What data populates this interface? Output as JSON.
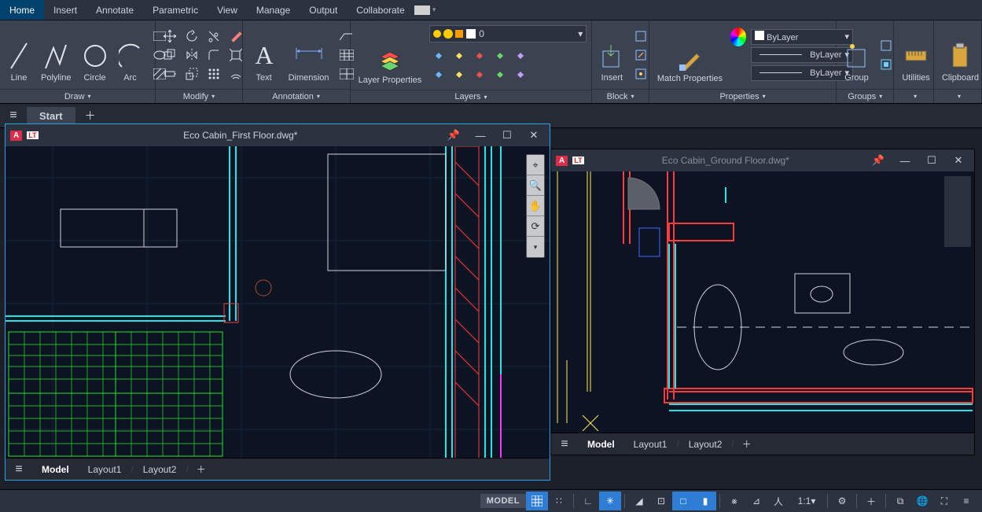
{
  "menubar": [
    "Home",
    "Insert",
    "Annotate",
    "Parametric",
    "View",
    "Manage",
    "Output",
    "Collaborate"
  ],
  "menubar_active": 0,
  "ribbon": {
    "draw": {
      "label": "Draw",
      "buttons": [
        "Line",
        "Polyline",
        "Circle",
        "Arc"
      ]
    },
    "modify": {
      "label": "Modify"
    },
    "annotation": {
      "label": "Annotation",
      "text": "Text",
      "dimension": "Dimension"
    },
    "layers": {
      "label": "Layers",
      "layer_props": "Layer\nProperties",
      "current_layer": "0"
    },
    "block": {
      "label": "Block",
      "insert": "Insert"
    },
    "properties": {
      "label": "Properties",
      "match": "Match\nProperties",
      "color": "ByLayer",
      "lw": "ByLayer",
      "lt": "ByLayer"
    },
    "groups": {
      "label": "Groups",
      "group": "Group"
    },
    "utilities": {
      "label": "Utilities"
    },
    "clipboard": {
      "label": "Clipboard"
    }
  },
  "doctab": {
    "start": "Start"
  },
  "windows": [
    {
      "title": "Eco Cabin_First Floor.dwg*",
      "active": true,
      "layout_tabs": [
        "Model",
        "Layout1",
        "Layout2"
      ],
      "active_layout": 0
    },
    {
      "title": "Eco Cabin_Ground Floor.dwg*",
      "active": false,
      "layout_tabs": [
        "Model",
        "Layout1",
        "Layout2"
      ],
      "active_layout": 0
    }
  ],
  "statusbar": {
    "model": "MODEL",
    "scale": "1:1"
  },
  "nav_icons": [
    "compass-icon",
    "zoom-extents-icon",
    "pan-icon",
    "orbit-icon"
  ]
}
